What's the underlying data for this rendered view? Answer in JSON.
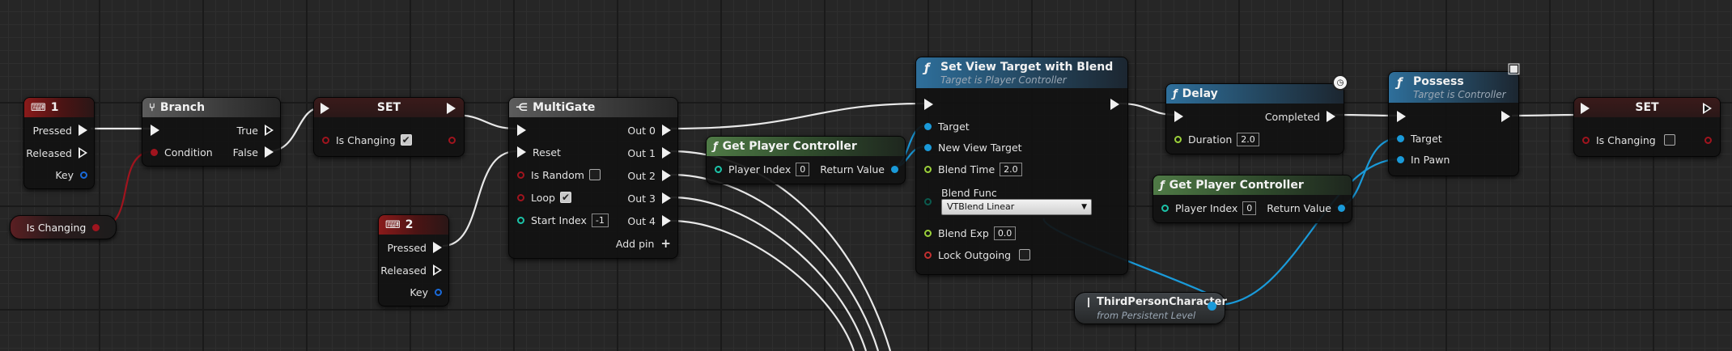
{
  "nodes": {
    "key1": {
      "title": "1",
      "pins": [
        "Pressed",
        "Released",
        "Key"
      ]
    },
    "key2": {
      "title": "2",
      "pins": [
        "Pressed",
        "Released",
        "Key"
      ]
    },
    "is_changing_var": {
      "label": "Is Changing"
    },
    "branch": {
      "title": "Branch",
      "condition": "Condition",
      "true_label": "True",
      "false_label": "False"
    },
    "set1": {
      "title": "SET",
      "pin": "Is Changing",
      "checked": true
    },
    "multigate": {
      "title": "MultiGate",
      "inputs": [
        "Reset",
        "Is Random",
        "Loop",
        "Start Index"
      ],
      "start_index": "-1",
      "outputs": [
        "Out 0",
        "Out 1",
        "Out 2",
        "Out 3",
        "Out 4"
      ],
      "add_pin": "Add pin"
    },
    "gpc1": {
      "title": "Get Player Controller",
      "player_index_label": "Player Index",
      "player_index": "0",
      "return_value": "Return Value"
    },
    "set_view_target": {
      "title": "Set View Target with Blend",
      "subtitle": "Target is Player Controller",
      "target": "Target",
      "new_view_target": "New View Target",
      "blend_time_label": "Blend Time",
      "blend_time": "2.0",
      "blend_func_label": "Blend Func",
      "blend_func": "VTBlend Linear",
      "blend_exp_label": "Blend Exp",
      "blend_exp": "0.0",
      "lock_outgoing": "Lock Outgoing"
    },
    "delay": {
      "title": "Delay",
      "completed": "Completed",
      "duration_label": "Duration",
      "duration": "2.0"
    },
    "gpc2": {
      "title": "Get Player Controller",
      "player_index_label": "Player Index",
      "player_index": "0",
      "return_value": "Return Value"
    },
    "third_person": {
      "title": "ThirdPersonCharacter",
      "subtitle": "from Persistent Level"
    },
    "possess": {
      "title": "Possess",
      "subtitle": "Target is Controller",
      "target": "Target",
      "in_pawn": "In Pawn"
    },
    "set2": {
      "title": "SET",
      "pin": "Is Changing",
      "checked": false
    }
  },
  "colors": {
    "event_header": "#8a1a1a",
    "function_header": "#2e6f9b",
    "pure_header": "#4f7a46",
    "exec_wire": "#e8e8e8",
    "object_wire": "#1a9ad9",
    "bool_wire": "#a0141e"
  },
  "icons": [
    "keyboard-icon",
    "branch-icon",
    "multigate-icon",
    "function-icon",
    "clock-icon",
    "network-icon"
  ]
}
